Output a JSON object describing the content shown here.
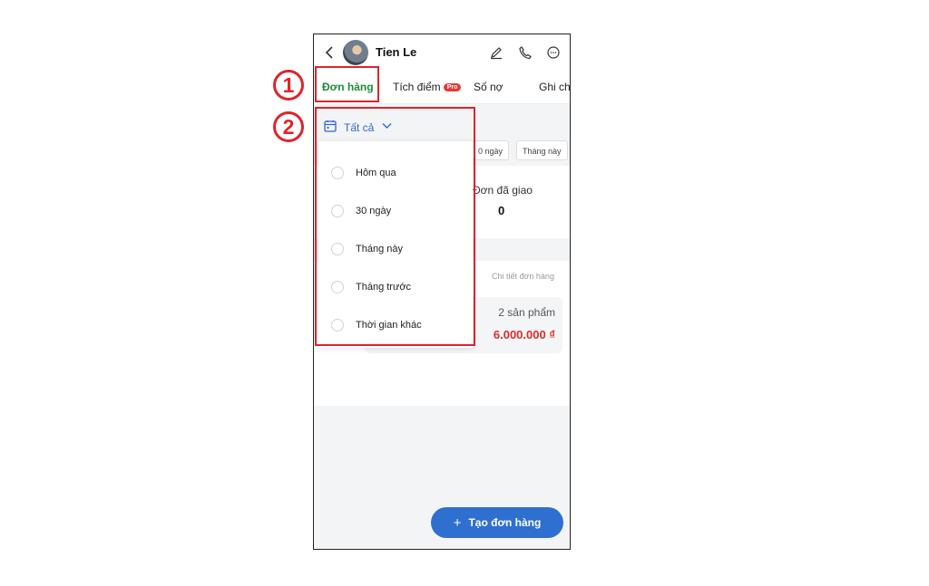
{
  "header": {
    "contact_name": "Tien Le",
    "icons": [
      "back-icon",
      "edit-icon",
      "phone-icon",
      "chat-icon"
    ]
  },
  "tabs": [
    {
      "label": "Đơn hàng",
      "active": true
    },
    {
      "label": "Tích điểm",
      "badge": "Pro"
    },
    {
      "label": "Số nợ"
    },
    {
      "label": "Ghi ch"
    }
  ],
  "filter": {
    "selected": "Tất cả",
    "chips": [
      "0 ngày",
      "Tháng này"
    ]
  },
  "dropdown_options": [
    "Hôm qua",
    "30 ngày",
    "Tháng này",
    "Tháng trước",
    "Thời gian khác"
  ],
  "stats": {
    "delivered_label": "Đơn đã giao",
    "delivered_value": "0"
  },
  "orders": {
    "detail_link": "Chi tiết đơn hàng",
    "item_count": "2 sản phẩm",
    "total": "6.000.000 ₫"
  },
  "create_order_button": "Tạo đơn hàng",
  "annotations": [
    "1",
    "2"
  ],
  "colors": {
    "active_tab": "#1e8b3a",
    "accent_blue": "#2f6fd0",
    "price_red": "#e02b2b",
    "annotation_red": "#e0232b",
    "pro_badge": "#e53935"
  }
}
